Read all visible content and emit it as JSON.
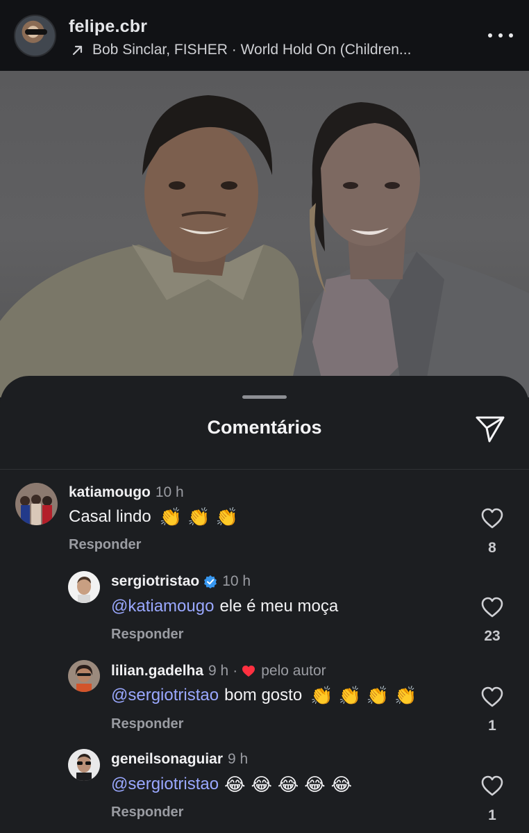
{
  "post": {
    "username": "felipe.cbr",
    "music": "Bob Sinclar, FISHER · World Hold On (Children..."
  },
  "sheet": {
    "title": "Comentários"
  },
  "comments": [
    {
      "user": "katiamougo",
      "time": "10 h",
      "mention": "",
      "text": "Casal lindo",
      "emojis": [
        "👏",
        "👏",
        "👏"
      ],
      "reply": "Responder",
      "likes": "8"
    },
    {
      "user": "sergiotristao",
      "time": "10 h",
      "verified": true,
      "mention": "@katiamougo",
      "text": "ele é meu moça",
      "emojis": [],
      "reply": "Responder",
      "likes": "23"
    },
    {
      "user": "lilian.gadelha",
      "time": "9 h",
      "separator": "·",
      "liked_by": "pelo autor",
      "mention": "@sergiotristao",
      "text": "bom gosto",
      "emojis": [
        "👏",
        "👏",
        "👏",
        "👏"
      ],
      "reply": "Responder",
      "likes": "1"
    },
    {
      "user": "geneilsonaguiar",
      "time": "9 h",
      "mention": "@sergiotristao",
      "text": "",
      "emojis": [
        "😂",
        "😂",
        "😂",
        "😂",
        "😂"
      ],
      "reply": "Responder",
      "likes": "1"
    }
  ],
  "colors": {
    "background": "#1c1e21",
    "mention": "#9aa8ff",
    "verified": "#3797f0",
    "heart": "#ff3040"
  },
  "icons": [
    "arrow-up-right-icon",
    "more-icon",
    "send-icon",
    "heart-outline-icon",
    "verified-badge-icon",
    "heart-filled-icon"
  ]
}
